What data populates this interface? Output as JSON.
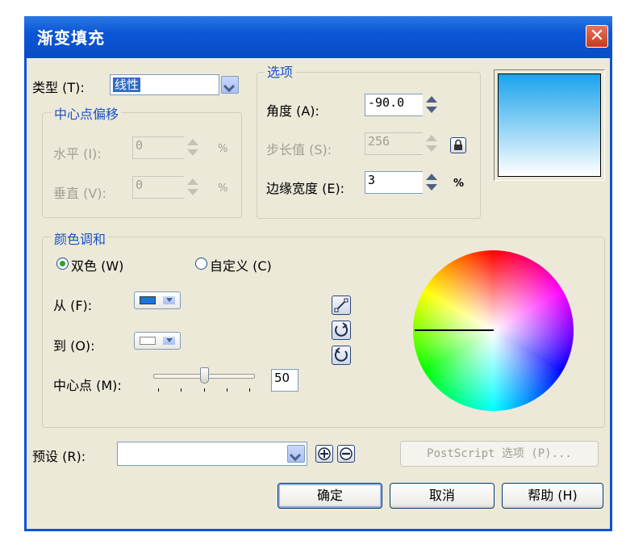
{
  "dialog": {
    "title": "渐变填充",
    "close_glyph": "✕"
  },
  "type": {
    "label": "类型 (T):",
    "value": "线性"
  },
  "center_offset": {
    "legend": "中心点偏移",
    "horizontal_label": "水平 (I):",
    "horizontal_value": "0",
    "vertical_label": "垂直 (V):",
    "vertical_value": "0",
    "unit": "%"
  },
  "options": {
    "legend": "选项",
    "angle_label": "角度 (A):",
    "angle_value": "-90.0",
    "steps_label": "步长值 (S):",
    "steps_value": "256",
    "edge_label": "边缘宽度 (E):",
    "edge_value": "3",
    "unit": "%"
  },
  "preview": {
    "gradient_top": "#1aa3ec",
    "gradient_bottom": "#ffffff"
  },
  "color_blend": {
    "legend": "颜色调和",
    "two_color_label": "双色 (W)",
    "two_color_checked": true,
    "custom_label": "自定义 (C)",
    "custom_checked": false,
    "from_label": "从 (F):",
    "from_color": "#1a75d8",
    "to_label": "到 (O):",
    "to_color": "#ffffff",
    "midpoint_label": "中心点 (M):",
    "midpoint_value": "50",
    "midpoint_percent": 50
  },
  "preset": {
    "label": "预设 (R):",
    "value": "",
    "postscript_label": "PostScript 选项 (P)..."
  },
  "buttons": {
    "ok": "确定",
    "cancel": "取消",
    "help": "帮助 (H)"
  },
  "colors": {
    "accent_title": "#0a4cc6",
    "group_label": "#1a52c8",
    "disabled": "#a19f93"
  }
}
